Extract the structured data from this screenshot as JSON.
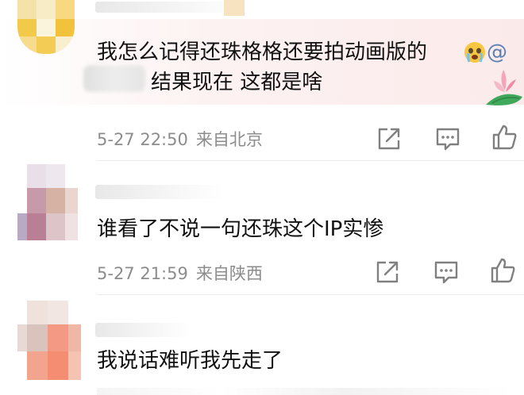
{
  "comments": [
    {
      "text_line1": "我怎么记得还珠格格还要拍动画版的",
      "mention_symbol": "@",
      "emoji": "crying-face-emoji",
      "text_line2": "结果现在 这都是啥",
      "time": "5-27 22:50",
      "location": "来自北京"
    },
    {
      "text": "谁看了不说一句还珠这个IP实惨",
      "time": "5-27 21:59",
      "location": "来自陕西"
    },
    {
      "text": "我说话难听我先走了"
    }
  ],
  "actions": [
    "share-icon",
    "comment-icon",
    "like-icon"
  ],
  "colors": {
    "text": "#111111",
    "meta": "#8c8c8c",
    "icon": "#808080",
    "highlight": "#fbeaea",
    "divider": "#ececec"
  }
}
